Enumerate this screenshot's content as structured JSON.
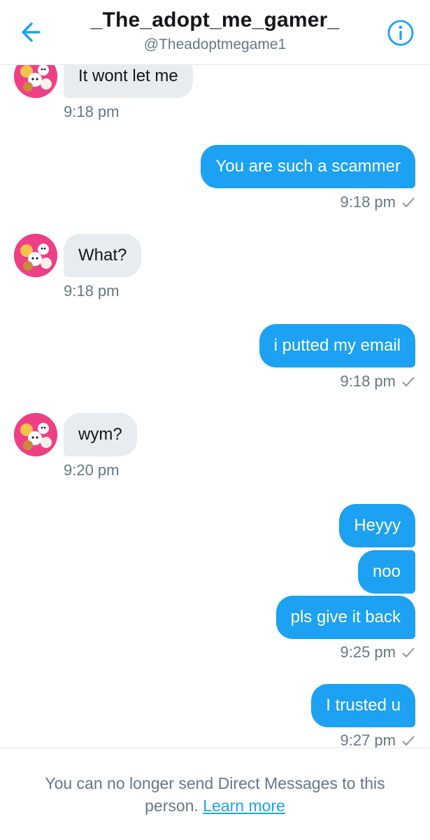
{
  "header": {
    "title": "_The_adopt_me_gamer_",
    "handle": "@Theadoptmegame1",
    "back_icon": "arrow-left-icon",
    "info_icon": "info-icon",
    "accent_color": "#1da1f2"
  },
  "messages": [
    {
      "direction": "in",
      "text": "It wont let me",
      "time": "9:18 pm"
    },
    {
      "direction": "out",
      "text": "You are such a scammer",
      "time": "9:18 pm"
    },
    {
      "direction": "in",
      "text": "What?",
      "time": "9:18 pm"
    },
    {
      "direction": "out",
      "text": "i putted my email",
      "time": "9:18 pm"
    },
    {
      "direction": "in",
      "text": "wym?",
      "time": "9:20 pm"
    },
    {
      "direction": "out",
      "text": "Heyyy"
    },
    {
      "direction": "out",
      "text": "noo"
    },
    {
      "direction": "out",
      "text": "pls give it back",
      "time": "9:25 pm"
    },
    {
      "direction": "out",
      "text": "I trusted u",
      "time": "9:27 pm"
    }
  ],
  "footer": {
    "notice": "You can no longer send Direct Messages to this person.",
    "link": "Learn more"
  },
  "colors": {
    "sent_bubble": "#1da1f2",
    "received_bubble": "#e6ecf0",
    "meta_text": "#657786"
  }
}
